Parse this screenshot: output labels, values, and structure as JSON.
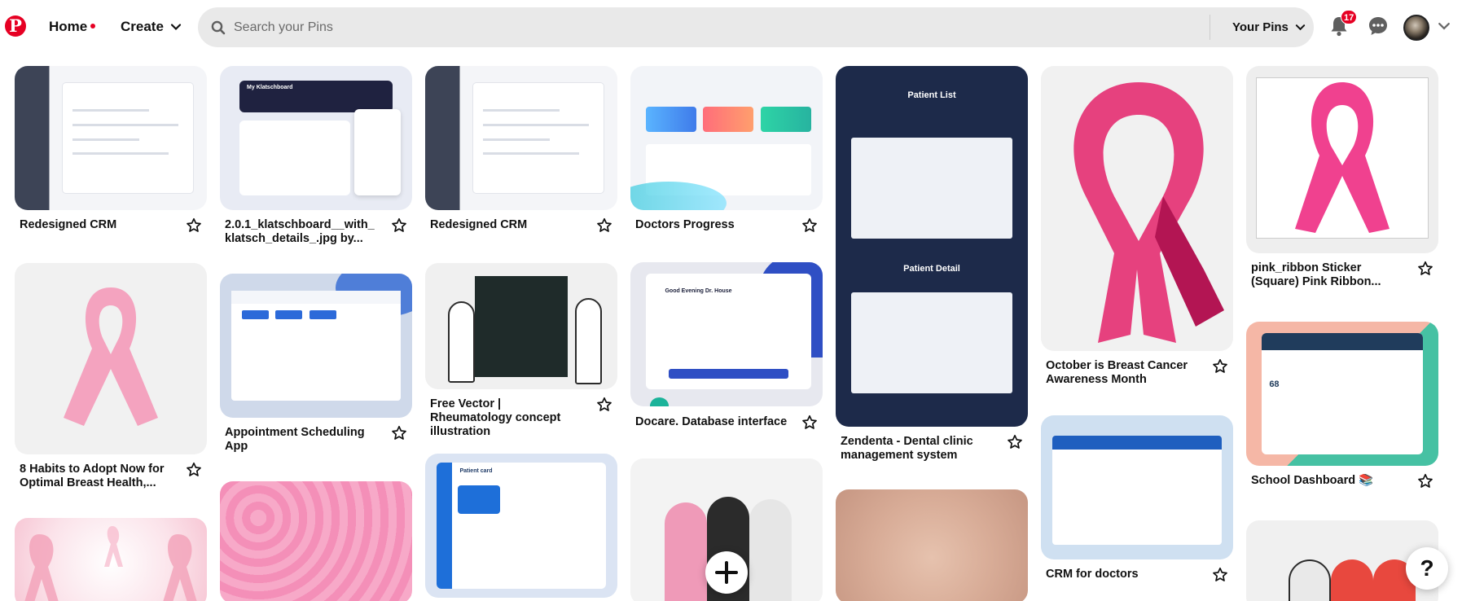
{
  "header": {
    "logo_text": "P",
    "home_label": "Home",
    "create_label": "Create",
    "search_placeholder": "Search your Pins",
    "your_pins_label": "Your Pins",
    "notification_count": "17"
  },
  "pins": [
    {
      "title": "Redesigned CRM"
    },
    {
      "title": "2.0.1_klatschboard__with_ klatsch_details_.jpg by..."
    },
    {
      "title": "Redesigned CRM"
    },
    {
      "title": "Doctors Progress"
    },
    {
      "title": "Zendenta - Dental clinic management system"
    },
    {
      "title": "October is Breast Cancer Awareness Month"
    },
    {
      "title": "pink_ribbon Sticker (Square) Pink Ribbon..."
    },
    {
      "title": "8 Habits to Adopt Now for Optimal Breast Health,..."
    },
    {
      "title": "Appointment Scheduling App"
    },
    {
      "title": "Free Vector | Rheumatology concept illustration"
    },
    {
      "title": "Docare. Database interface"
    },
    {
      "title": "CRM for doctors"
    },
    {
      "title": "School Dashboard 📚"
    }
  ],
  "image_text": {
    "klatsch_heading": "My Klatschboard",
    "zendenta_list": "Patient List",
    "zendenta_detail": "Patient Detail",
    "docare_greeting": "Good Evening Dr. House",
    "patient_card_title": "Patient card",
    "school_stat": "68"
  },
  "floating": {
    "help_label": "?"
  },
  "colors": {
    "brand": "#e60023",
    "search_bg": "#e9e9e9",
    "pink_ribbon": "#f06ba3"
  }
}
